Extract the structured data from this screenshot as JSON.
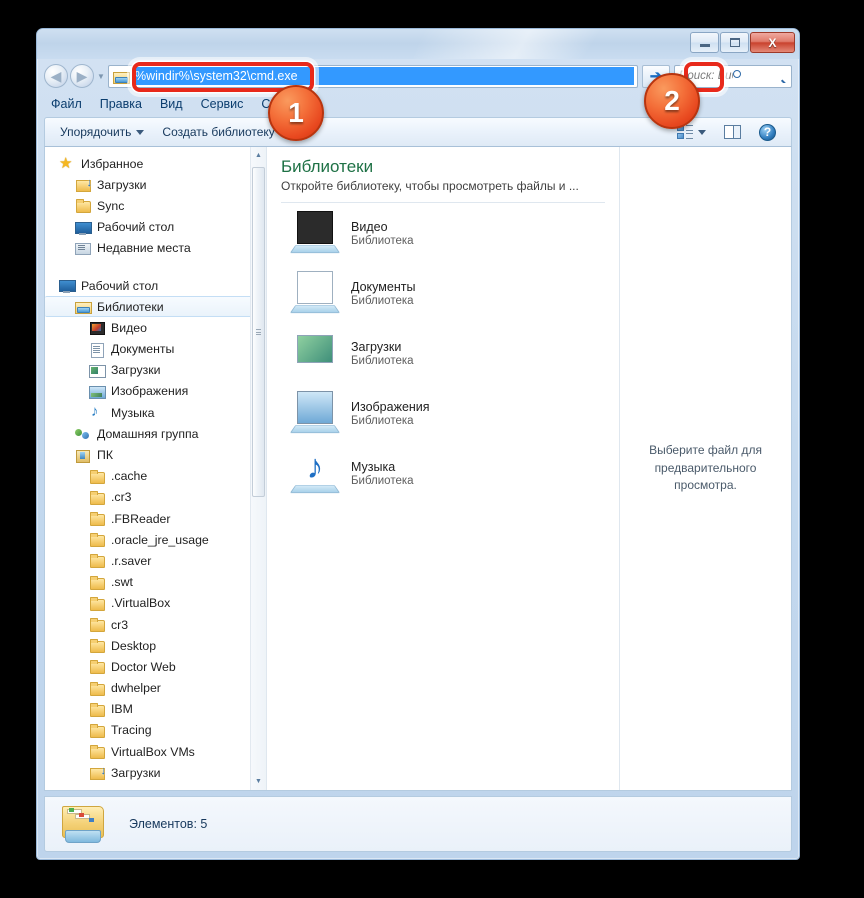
{
  "window": {
    "title": "",
    "controls": {
      "minimize": "Свернуть",
      "maximize": "Развернуть",
      "close": "Закрыть",
      "close_glyph": "X"
    }
  },
  "navigation": {
    "back_label": "Назад",
    "forward_label": "Вперед",
    "history_label": "Последние страницы",
    "address_value": "%windir%\\system32\\cmd.exe",
    "go_label": "Перейти",
    "go_glyph": "➔",
    "search_placeholder": "Поиск: Биб..."
  },
  "menubar": {
    "items": [
      {
        "label": "Файл"
      },
      {
        "label": "Правка"
      },
      {
        "label": "Вид"
      },
      {
        "label": "Сервис"
      },
      {
        "label": "Справка"
      }
    ]
  },
  "commandbar": {
    "organize": "Упорядочить",
    "new_library": "Создать библиотеку",
    "view_label": "Изменить представление",
    "preview_label": "Область предварительного просмотра",
    "help_label": "Справка",
    "help_glyph": "?"
  },
  "navpane": {
    "items": [
      {
        "label": "Избранное",
        "icon": "star-icon",
        "indent": 0
      },
      {
        "label": "Загрузки",
        "icon": "folder-download-icon",
        "indent": 1
      },
      {
        "label": "Sync",
        "icon": "folder-icon",
        "indent": 1
      },
      {
        "label": "Рабочий стол",
        "icon": "desktop-icon",
        "indent": 1
      },
      {
        "label": "Недавние места",
        "icon": "recent-places-icon",
        "indent": 1
      },
      {
        "label": "Рабочий стол",
        "icon": "desktop-icon",
        "indent": 0
      },
      {
        "label": "Библиотеки",
        "icon": "libraries-icon",
        "indent": 1,
        "selected": true
      },
      {
        "label": "Видео",
        "icon": "video-icon",
        "indent": 2
      },
      {
        "label": "Документы",
        "icon": "documents-icon",
        "indent": 2
      },
      {
        "label": "Загрузки",
        "icon": "downloads-library-icon",
        "indent": 2
      },
      {
        "label": "Изображения",
        "icon": "pictures-icon",
        "indent": 2
      },
      {
        "label": "Музыка",
        "icon": "music-icon",
        "indent": 2
      },
      {
        "label": "Домашняя группа",
        "icon": "homegroup-icon",
        "indent": 1
      },
      {
        "label": "ПК",
        "icon": "user-folder-icon",
        "indent": 1
      },
      {
        "label": ".cache",
        "icon": "folder-icon",
        "indent": 2
      },
      {
        "label": ".cr3",
        "icon": "folder-icon",
        "indent": 2
      },
      {
        "label": ".FBReader",
        "icon": "folder-icon",
        "indent": 2
      },
      {
        "label": ".oracle_jre_usage",
        "icon": "folder-icon",
        "indent": 2
      },
      {
        "label": ".r.saver",
        "icon": "folder-icon",
        "indent": 2
      },
      {
        "label": ".swt",
        "icon": "folder-icon",
        "indent": 2
      },
      {
        "label": ".VirtualBox",
        "icon": "folder-icon",
        "indent": 2
      },
      {
        "label": "cr3",
        "icon": "folder-icon",
        "indent": 2
      },
      {
        "label": "Desktop",
        "icon": "folder-icon",
        "indent": 2
      },
      {
        "label": "Doctor Web",
        "icon": "folder-icon",
        "indent": 2
      },
      {
        "label": "dwhelper",
        "icon": "folder-icon",
        "indent": 2
      },
      {
        "label": "IBM",
        "icon": "folder-icon",
        "indent": 2
      },
      {
        "label": "Tracing",
        "icon": "folder-icon",
        "indent": 2
      },
      {
        "label": "VirtualBox VMs",
        "icon": "folder-icon",
        "indent": 2
      },
      {
        "label": "Загрузки",
        "icon": "folder-download-icon",
        "indent": 2
      }
    ]
  },
  "content": {
    "heading": "Библиотеки",
    "subheading": "Откройте библиотеку, чтобы просмотреть файлы и ...",
    "items": [
      {
        "name": "Видео",
        "type": "Библиотека",
        "icon": "video-library-icon"
      },
      {
        "name": "Документы",
        "type": "Библиотека",
        "icon": "documents-library-icon"
      },
      {
        "name": "Загрузки",
        "type": "Библиотека",
        "icon": "downloads-library-icon"
      },
      {
        "name": "Изображения",
        "type": "Библиотека",
        "icon": "pictures-library-icon"
      },
      {
        "name": "Музыка",
        "type": "Библиотека",
        "icon": "music-library-icon"
      }
    ]
  },
  "preview": {
    "message": "Выберите файл для предварительного просмотра."
  },
  "statusbar": {
    "text": "Элементов: 5"
  },
  "annotations": [
    {
      "number": "1",
      "target": "address-bar"
    },
    {
      "number": "2",
      "target": "go-button"
    }
  ],
  "colors": {
    "accent_green": "#1e7145",
    "selection_blue": "#3399ff",
    "annotation_red": "#e8291b",
    "badge_orange": "#f4703a"
  }
}
